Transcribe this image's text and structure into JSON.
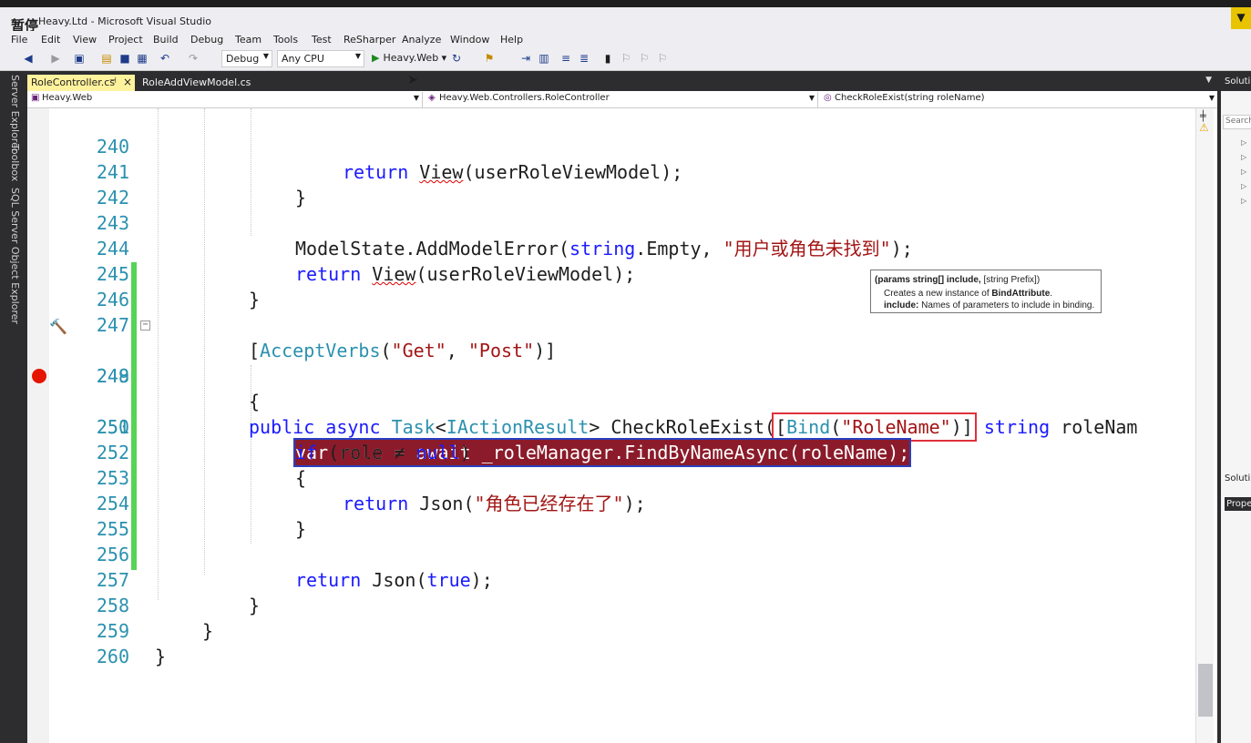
{
  "window": {
    "badge": "暂停",
    "title": "Heavy.Ltd - Microsoft Visual Studio"
  },
  "menu": [
    "File",
    "Edit",
    "View",
    "Project",
    "Build",
    "Debug",
    "Team",
    "Tools",
    "Test",
    "ReSharper",
    "Analyze",
    "Window",
    "Help"
  ],
  "toolbar": {
    "config": "Debug",
    "platform": "Any CPU",
    "start_target": "Heavy.Web"
  },
  "side_tabs": [
    "Server Explorer",
    "Toolbox",
    "SQL Server Object Explorer"
  ],
  "tabs": [
    {
      "label": "RoleController.cs",
      "active": true
    },
    {
      "label": "RoleAddViewModel.cs",
      "active": false
    }
  ],
  "navbar": {
    "project": "Heavy.Web",
    "type": "Heavy.Web.Controllers.RoleController",
    "member": "CheckRoleExist(string roleName)"
  },
  "code": {
    "lines": [
      {
        "n": "240"
      },
      {
        "n": "241"
      },
      {
        "n": "242"
      },
      {
        "n": "243"
      },
      {
        "n": "244"
      },
      {
        "n": "245"
      },
      {
        "n": "246"
      },
      {
        "n": "247"
      },
      {
        "n": "248"
      },
      {
        "n": "249"
      },
      {
        "n": "250"
      },
      {
        "n": "251"
      },
      {
        "n": "252"
      },
      {
        "n": "253"
      },
      {
        "n": "254"
      },
      {
        "n": "255"
      },
      {
        "n": "256"
      },
      {
        "n": "257"
      },
      {
        "n": "258"
      },
      {
        "n": "259"
      },
      {
        "n": "260"
      }
    ],
    "t240": [
      "return",
      "View",
      "(userRoleViewModel);"
    ],
    "t241": "}",
    "t243": [
      "ModelState.AddModelError(",
      "string",
      ".Empty, ",
      "\"用户或角色未找到\"",
      ");"
    ],
    "t244": [
      "return",
      "View",
      "(userRoleViewModel);"
    ],
    "t245": "}",
    "t247": [
      "[",
      "AcceptVerbs",
      "(",
      "\"Get\"",
      ", ",
      "\"Post\"",
      ")]"
    ],
    "t248": [
      "public",
      "async",
      "Task",
      "<",
      "IActionResult",
      "> CheckRoleExist(",
      "[",
      "Bind",
      "(",
      "\"RoleName\"",
      ")]",
      "string",
      "roleNam"
    ],
    "t249": "{",
    "t250": "var role = await _roleManager.FindByNameAsync(roleName);",
    "t251": [
      "if",
      " (role ≠ ",
      "null",
      ")"
    ],
    "t252": "{",
    "t253": [
      "return",
      " Json(",
      "\"角色已经存在了\"",
      ");"
    ],
    "t254": "}",
    "t256": [
      "return",
      " Json(",
      "true",
      ");"
    ],
    "t257": "}",
    "t258": "}",
    "t259": "}"
  },
  "tooltip": {
    "signature_bold": "(params string[] include,",
    "signature_rest": " [string Prefix])",
    "desc_pre": "Creates a new instance of ",
    "desc_bold": "BindAttribute",
    "desc_post": ".",
    "param_bold": "include:",
    "param_desc": " Names of parameters to include in binding."
  },
  "right_pane": {
    "header": "Soluti",
    "search": "Search",
    "label2": "Soluti",
    "label3": "Prope"
  }
}
